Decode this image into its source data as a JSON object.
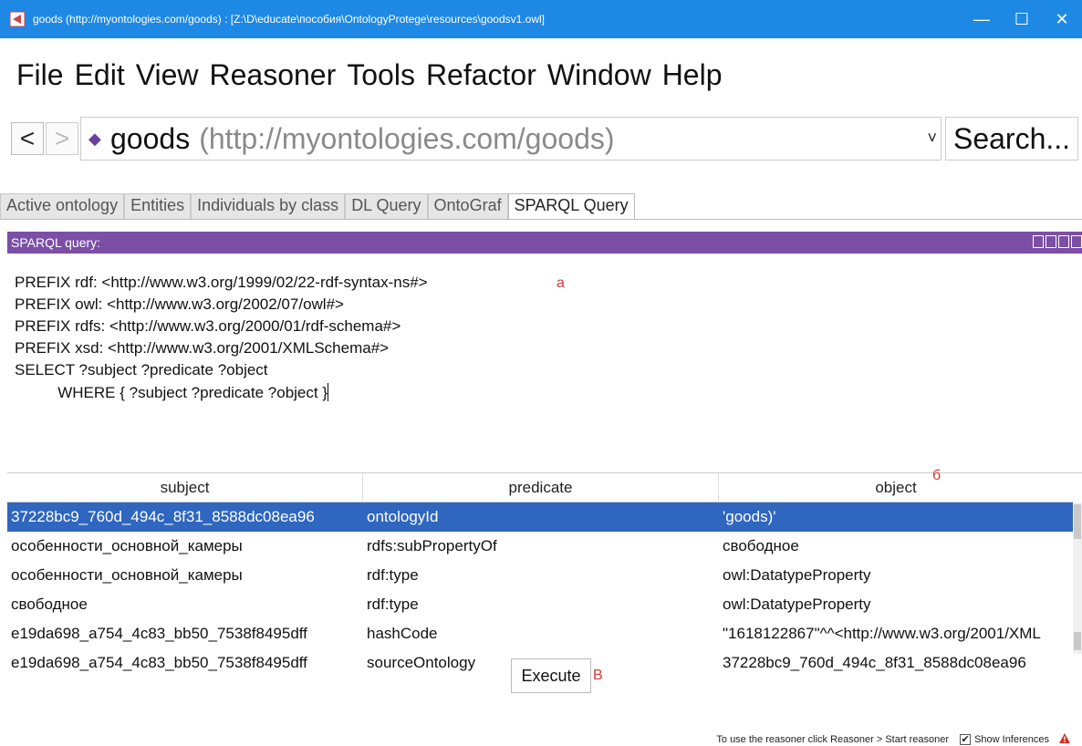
{
  "window": {
    "title": "goods (http://myontologies.com/goods) : [Z:\\D\\educate\\пособия\\OntologyProtege\\resources\\goodsv1.owl]",
    "controls": [
      "—",
      "☐",
      "✕"
    ]
  },
  "menu": [
    "File",
    "Edit",
    "View",
    "Reasoner",
    "Tools",
    "Refactor",
    "Window",
    "Help"
  ],
  "nav": {
    "back": "<",
    "forward": ">",
    "ontology_name": "goods",
    "ontology_iri": "(http://myontologies.com/goods)",
    "dropdown_arrow": "˅",
    "search_label": "Search..."
  },
  "tabs": [
    {
      "label": "Active ontology",
      "active": false
    },
    {
      "label": "Entities",
      "active": false
    },
    {
      "label": "Individuals by class",
      "active": false
    },
    {
      "label": "DL Query",
      "active": false
    },
    {
      "label": "OntoGraf",
      "active": false
    },
    {
      "label": "SPARQL Query",
      "active": true
    }
  ],
  "view": {
    "title": "SPARQL query:",
    "header_color": "#7b4fa6"
  },
  "query": {
    "lines": [
      "PREFIX rdf: <http://www.w3.org/1999/02/22-rdf-syntax-ns#>",
      "PREFIX owl: <http://www.w3.org/2002/07/owl#>",
      "PREFIX rdfs: <http://www.w3.org/2000/01/rdf-schema#>",
      "PREFIX xsd: <http://www.w3.org/2001/XMLSchema#>",
      "SELECT ?subject ?predicate ?object",
      "          WHERE { ?subject ?predicate ?object }"
    ]
  },
  "markers": {
    "a": "а",
    "b": "б",
    "v": "В",
    "color": "#d13a3a"
  },
  "results": {
    "columns": [
      "subject",
      "predicate",
      "object"
    ],
    "rows": [
      {
        "subject": "37228bc9_760d_494c_8f31_8588dc08ea96",
        "predicate": "ontologyId",
        "object": "'goods)'",
        "selected": true
      },
      {
        "subject": "особенности_основной_камеры",
        "predicate": "rdfs:subPropertyOf",
        "object": "свободное",
        "selected": false
      },
      {
        "subject": "особенности_основной_камеры",
        "predicate": "rdf:type",
        "object": "owl:DatatypeProperty",
        "selected": false
      },
      {
        "subject": "свободное",
        "predicate": "rdf:type",
        "object": "owl:DatatypeProperty",
        "selected": false
      },
      {
        "subject": "e19da698_a754_4c83_bb50_7538f8495dff",
        "predicate": "hashCode",
        "object": "\"1618122867\"^^<http://www.w3.org/2001/XML",
        "selected": false
      },
      {
        "subject": "e19da698_a754_4c83_bb50_7538f8495dff",
        "predicate": "sourceOntology",
        "object": "37228bc9_760d_494c_8f31_8588dc08ea96",
        "selected": false
      }
    ],
    "selected_color": "#2f66bf"
  },
  "execute_label": "Execute",
  "status": {
    "hint": "To use the reasoner click Reasoner > Start reasoner",
    "show_inferences_label": "Show Inferences",
    "show_inferences_checked": true
  },
  "colors": {
    "titlebar": "#1e88e5"
  }
}
